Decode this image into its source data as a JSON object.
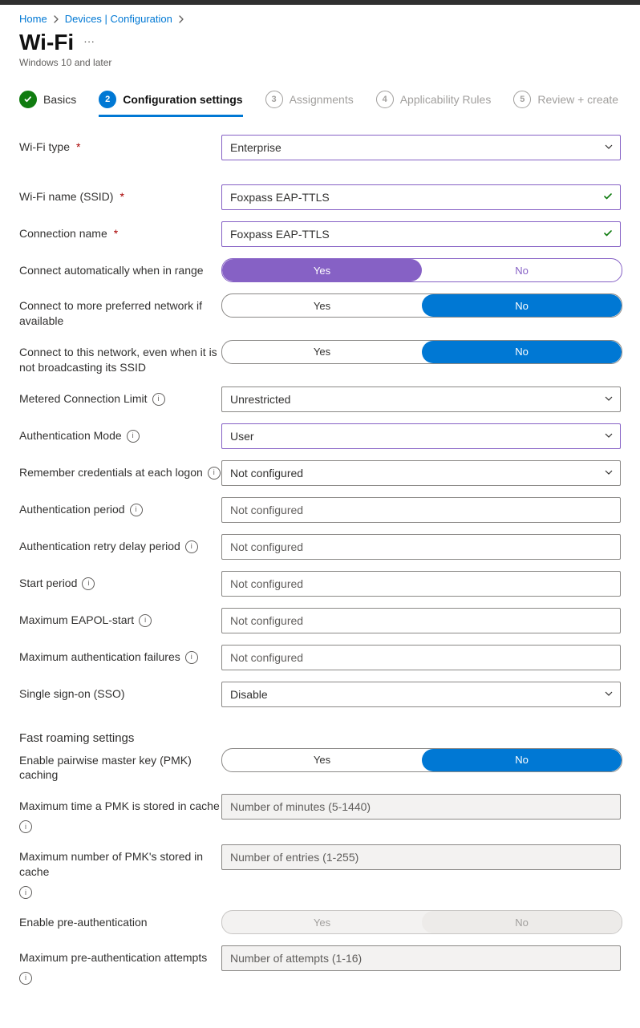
{
  "breadcrumb": {
    "home": "Home",
    "devices": "Devices | Configuration"
  },
  "header": {
    "title": "Wi-Fi",
    "subtitle": "Windows 10 and later"
  },
  "steps": {
    "s1": "Basics",
    "s2": "Configuration settings",
    "s3": "Assignments",
    "s4": "Applicability Rules",
    "s5": "Review + create",
    "n2": "2",
    "n3": "3",
    "n4": "4",
    "n5": "5"
  },
  "labels": {
    "wifi_type": "Wi-Fi type",
    "ssid": "Wi-Fi name (SSID)",
    "conn_name": "Connection name",
    "auto_connect": "Connect automatically when in range",
    "more_preferred": "Connect to more preferred network if available",
    "hidden_ssid": "Connect to this network, even when it is not broadcasting its SSID",
    "metered": "Metered Connection Limit",
    "auth_mode": "Authentication Mode",
    "remember": "Remember credentials at each logon",
    "auth_period": "Authentication period",
    "auth_retry": "Authentication retry delay period",
    "start_period": "Start period",
    "max_eapol": "Maximum EAPOL-start",
    "max_auth_fail": "Maximum authentication failures",
    "sso": "Single sign-on (SSO)",
    "fast_roaming": "Fast roaming settings",
    "pmk_caching": "Enable pairwise master key (PMK) caching",
    "pmk_time": "Maximum time a PMK is stored in cache",
    "pmk_num": "Maximum number of PMK's stored in cache",
    "preauth": "Enable pre-authentication",
    "preauth_attempts": "Maximum pre-authentication attempts"
  },
  "values": {
    "wifi_type": "Enterprise",
    "ssid": "Foxpass EAP-TTLS",
    "conn_name": "Foxpass EAP-TTLS",
    "metered": "Unrestricted",
    "auth_mode": "User",
    "remember": "Not configured",
    "sso": "Disable"
  },
  "placeholders": {
    "not_configured": "Not configured",
    "pmk_time": "Number of minutes (5-1440)",
    "pmk_num": "Number of entries (1-255)",
    "preauth_attempts": "Number of attempts (1-16)"
  },
  "toggle": {
    "yes": "Yes",
    "no": "No"
  },
  "asterisk": "*"
}
